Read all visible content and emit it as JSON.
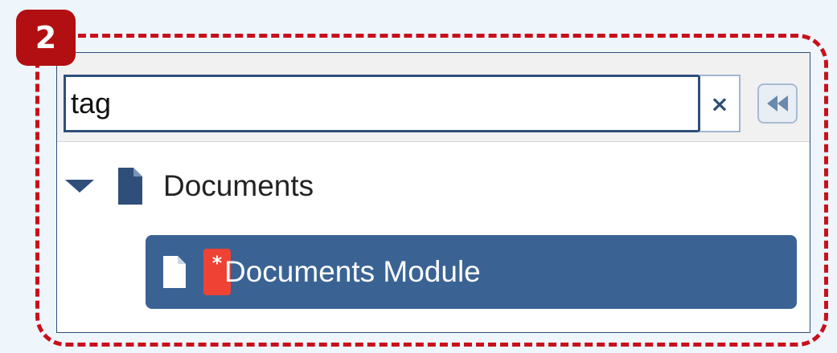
{
  "step_badge": {
    "number": "2"
  },
  "search": {
    "value": "tag"
  },
  "toolbar": {
    "clear_symbol": "×",
    "collapse_icon": "double-chevron-left-icon"
  },
  "tree": {
    "parent": {
      "label": "Documents",
      "icon": "document-icon",
      "expander": "caret-down-icon"
    },
    "child": {
      "label": "Documents Module",
      "icon": "document-icon",
      "badge": "*",
      "selected": true
    }
  },
  "colors": {
    "accent": "#c8101c",
    "selection": "#3a6394",
    "badge": "#ee4334",
    "background": "#eef5fb"
  }
}
